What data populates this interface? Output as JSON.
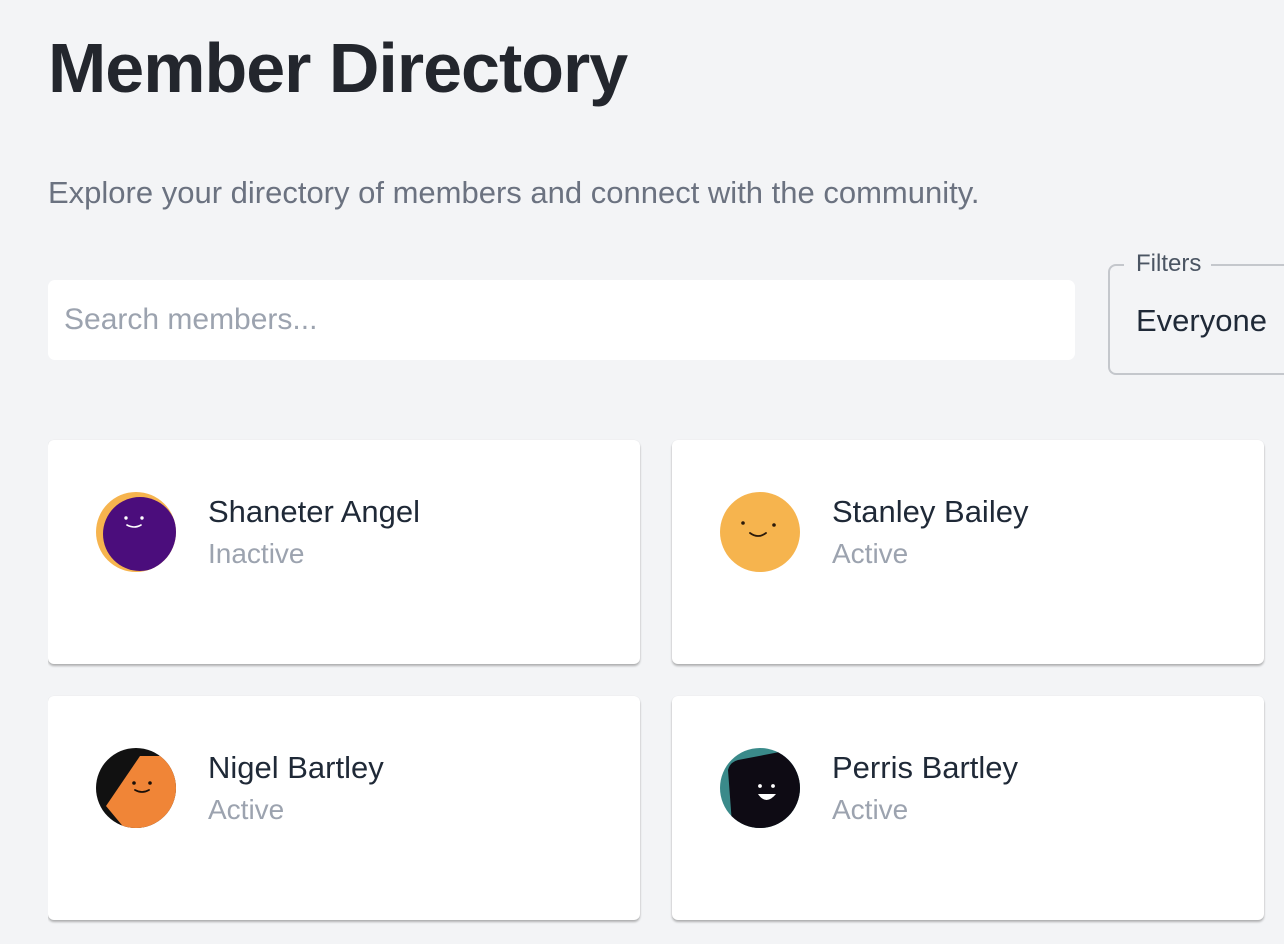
{
  "header": {
    "title": "Member Directory",
    "subtitle": "Explore your directory of members and connect with the community."
  },
  "search": {
    "placeholder": "Search members...",
    "value": ""
  },
  "filters": {
    "label": "Filters",
    "selected": "Everyone"
  },
  "members": [
    {
      "name": "Shaneter Angel",
      "status": "Inactive",
      "avatar_icon": "smiley-face-icon",
      "avatar_colors": [
        "#f6b44e",
        "#4b0d7c"
      ]
    },
    {
      "name": "Stanley Bailey",
      "status": "Active",
      "avatar_icon": "smiley-face-icon",
      "avatar_colors": [
        "#f6b44e"
      ]
    },
    {
      "name": "Nigel Bartley",
      "status": "Active",
      "avatar_icon": "smiley-face-icon",
      "avatar_colors": [
        "#111111",
        "#f08537"
      ]
    },
    {
      "name": "Perris Bartley",
      "status": "Active",
      "avatar_icon": "smiley-face-icon",
      "avatar_colors": [
        "#3a8a8a",
        "#0e0b14"
      ]
    }
  ],
  "colors": {
    "background": "#f3f4f6",
    "card": "#ffffff",
    "title": "#23262d",
    "muted_text": "#6b7280",
    "status_text": "#9ca3af"
  }
}
